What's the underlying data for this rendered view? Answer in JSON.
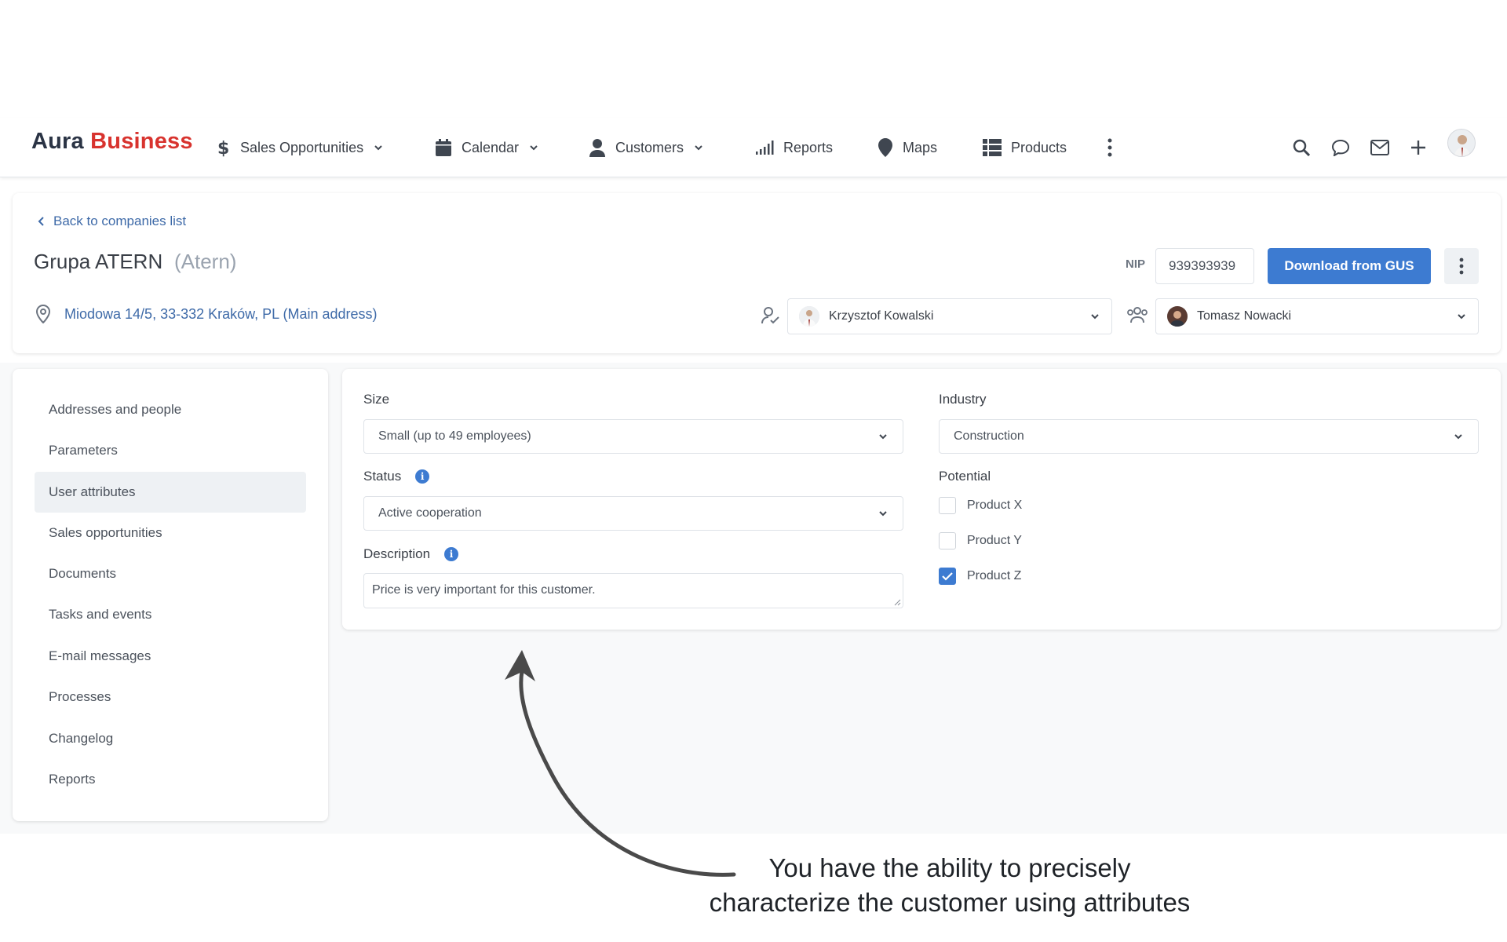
{
  "app": {
    "logo_part1": "Aura",
    "logo_part2": "Business"
  },
  "nav": {
    "sales": "Sales Opportunities",
    "calendar": "Calendar",
    "customers": "Customers",
    "reports": "Reports",
    "maps": "Maps",
    "products": "Products"
  },
  "header": {
    "back": "Back to companies list",
    "company_name": "Grupa ATERN",
    "company_alias": "(Atern)",
    "address": "Miodowa 14/5, 33-332 Kraków, PL (Main address)",
    "nip_label": "NIP",
    "nip_value": "939393939",
    "download_button": "Download from GUS",
    "owner": "Krzysztof Kowalski",
    "team_member": "Tomasz Nowacki"
  },
  "sidebar": {
    "items": [
      {
        "label": "Addresses and people"
      },
      {
        "label": "Parameters"
      },
      {
        "label": "User attributes",
        "active": true
      },
      {
        "label": "Sales opportunities"
      },
      {
        "label": "Documents"
      },
      {
        "label": "Tasks and events"
      },
      {
        "label": "E-mail messages"
      },
      {
        "label": "Processes"
      },
      {
        "label": "Changelog"
      },
      {
        "label": "Reports"
      }
    ]
  },
  "form": {
    "size_label": "Size",
    "size_value": "Small (up to 49 employees)",
    "status_label": "Status",
    "status_value": "Active cooperation",
    "description_label": "Description",
    "description_value": "Price is very important for this customer.",
    "industry_label": "Industry",
    "industry_value": "Construction",
    "potential_label": "Potential",
    "potential": [
      {
        "label": "Product X",
        "checked": false
      },
      {
        "label": "Product Y",
        "checked": false
      },
      {
        "label": "Product Z",
        "checked": true
      }
    ]
  },
  "annotation": {
    "line1": "You have the ability to precisely",
    "line2": "characterize the customer using attributes"
  },
  "colors": {
    "accent": "#3d7bd1",
    "brand_red": "#d8332e",
    "link": "#3e6aa8"
  },
  "icons": [
    "dollar-icon",
    "calendar-icon",
    "person-icon",
    "bar-chart-icon",
    "map-pin-icon",
    "grid-icon",
    "more-vertical-icon",
    "search-icon",
    "chat-icon",
    "mail-icon",
    "plus-icon",
    "chevron-left-icon",
    "location-icon",
    "owner-icon",
    "team-icon",
    "info-icon",
    "check-icon"
  ]
}
